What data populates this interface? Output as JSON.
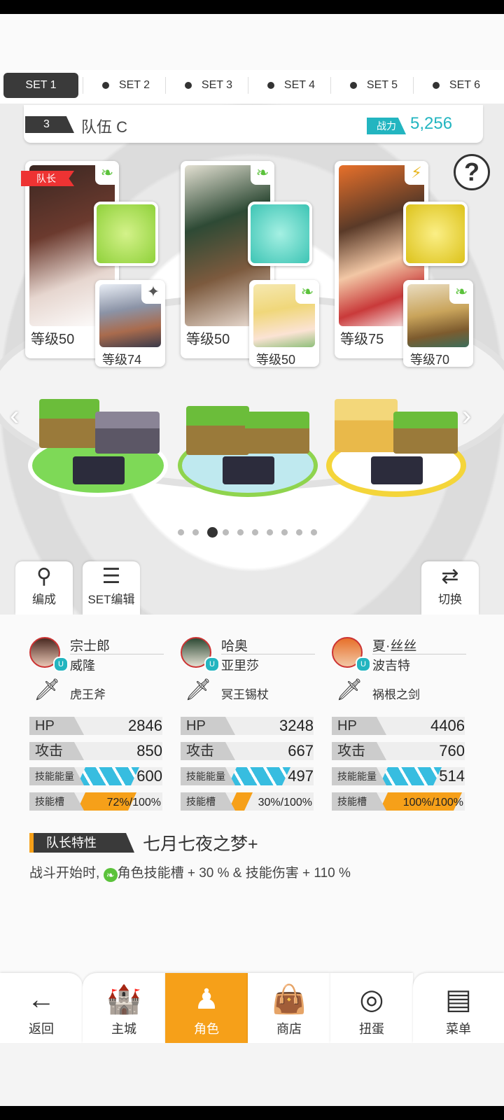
{
  "set_tabs": [
    {
      "label": "SET 1",
      "active": true
    },
    {
      "label": "SET 2",
      "active": false
    },
    {
      "label": "SET 3",
      "active": false
    },
    {
      "label": "SET 4",
      "active": false
    },
    {
      "label": "SET 5",
      "active": false
    },
    {
      "label": "SET 6",
      "active": false
    }
  ],
  "team": {
    "number": "3",
    "name": "队伍 C",
    "power_label": "战力",
    "power_value": "5,256"
  },
  "help_icon": "?",
  "leader_badge": "队长",
  "slots": [
    {
      "level": "等级50",
      "sub_level": "等级74",
      "element": "leaf-icon",
      "sub_element": "star-icon",
      "weapon_color": "#9fdc4a",
      "platform_color": "#7ed957"
    },
    {
      "level": "等级50",
      "sub_level": "等级50",
      "element": "leaf-icon",
      "sub_element": "leaf-icon",
      "weapon_color": "#5fd9c8",
      "platform_color": "#bfe9ef"
    },
    {
      "level": "等级75",
      "sub_level": "等级70",
      "element": "lightning-icon",
      "sub_element": "leaf-icon",
      "weapon_color": "#e8d21e",
      "platform_color": "#f4d53a"
    }
  ],
  "page_dots": {
    "count": 10,
    "active_index": 2
  },
  "tools": {
    "formation": "编成",
    "set_edit": "SET编辑",
    "switch": "切换"
  },
  "characters": [
    {
      "name": "宗士郎",
      "sub": "威隆",
      "weapon": "虎王斧",
      "hp_label": "HP",
      "hp": "2846",
      "atk_label": "攻击",
      "atk": "850",
      "energy_label": "技能能量",
      "energy": "600",
      "energy_fill": 0.75,
      "gauge_label": "技能槽",
      "gauge": "72%/100%",
      "gauge_fill": 0.72
    },
    {
      "name": "哈奥",
      "sub": "亚里莎",
      "weapon": "冥王锡杖",
      "hp_label": "HP",
      "hp": "3248",
      "atk_label": "攻击",
      "atk": "667",
      "energy_label": "技能能量",
      "energy": "497",
      "energy_fill": 0.75,
      "gauge_label": "技能槽",
      "gauge": "30%/100%",
      "gauge_fill": 0.3
    },
    {
      "name": "夏·丝丝",
      "sub": "波吉特",
      "weapon": "祸根之剑",
      "hp_label": "HP",
      "hp": "4406",
      "atk_label": "攻击",
      "atk": "760",
      "energy_label": "技能能量",
      "energy": "514",
      "energy_fill": 0.75,
      "gauge_label": "技能槽",
      "gauge": "100%/100%",
      "gauge_fill": 1.0
    }
  ],
  "leader_trait": {
    "tag": "队长特性",
    "name": "七月七夜之梦+",
    "desc_prefix": "战斗开始时,",
    "desc_suffix": "角色技能槽 + 30 % & 技能伤害 + 110 %"
  },
  "nav": [
    {
      "label": "返回",
      "icon": "back-arrow-icon",
      "active": false
    },
    {
      "label": "主城",
      "icon": "castle-icon",
      "active": false
    },
    {
      "label": "角色",
      "icon": "character-icon",
      "active": true
    },
    {
      "label": "商店",
      "icon": "shop-icon",
      "active": false
    },
    {
      "label": "扭蛋",
      "icon": "gacha-icon",
      "active": false
    },
    {
      "label": "菜单",
      "icon": "menu-icon",
      "active": false
    }
  ]
}
